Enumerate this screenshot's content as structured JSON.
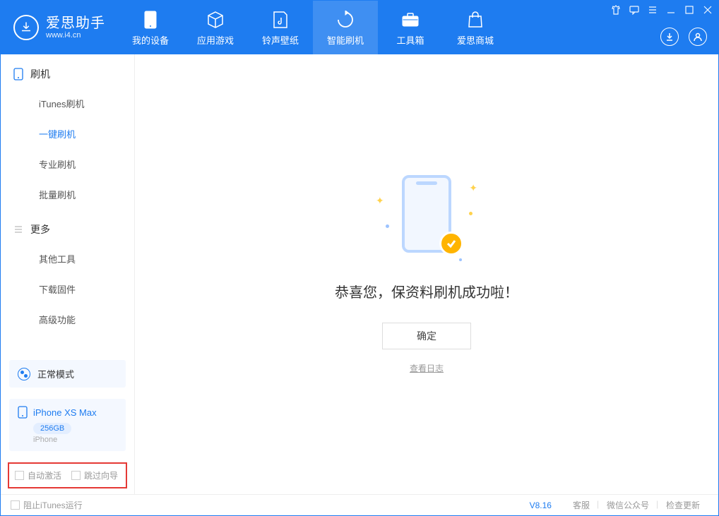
{
  "app": {
    "title": "爱思助手",
    "subtitle": "www.i4.cn"
  },
  "nav": {
    "items": [
      {
        "label": "我的设备"
      },
      {
        "label": "应用游戏"
      },
      {
        "label": "铃声壁纸"
      },
      {
        "label": "智能刷机"
      },
      {
        "label": "工具箱"
      },
      {
        "label": "爱思商城"
      }
    ]
  },
  "sidebar": {
    "group1": "刷机",
    "items1": [
      "iTunes刷机",
      "一键刷机",
      "专业刷机",
      "批量刷机"
    ],
    "group2": "更多",
    "items2": [
      "其他工具",
      "下载固件",
      "高级功能"
    ]
  },
  "mode": {
    "label": "正常模式"
  },
  "device": {
    "name": "iPhone XS Max",
    "storage": "256GB",
    "type": "iPhone"
  },
  "options": {
    "auto_activate": "自动激活",
    "skip_guide": "跳过向导"
  },
  "main": {
    "success_msg": "恭喜您，保资料刷机成功啦！",
    "ok_btn": "确定",
    "log_link": "查看日志"
  },
  "footer": {
    "block_itunes": "阻止iTunes运行",
    "version": "V8.16",
    "links": [
      "客服",
      "微信公众号",
      "检查更新"
    ]
  }
}
